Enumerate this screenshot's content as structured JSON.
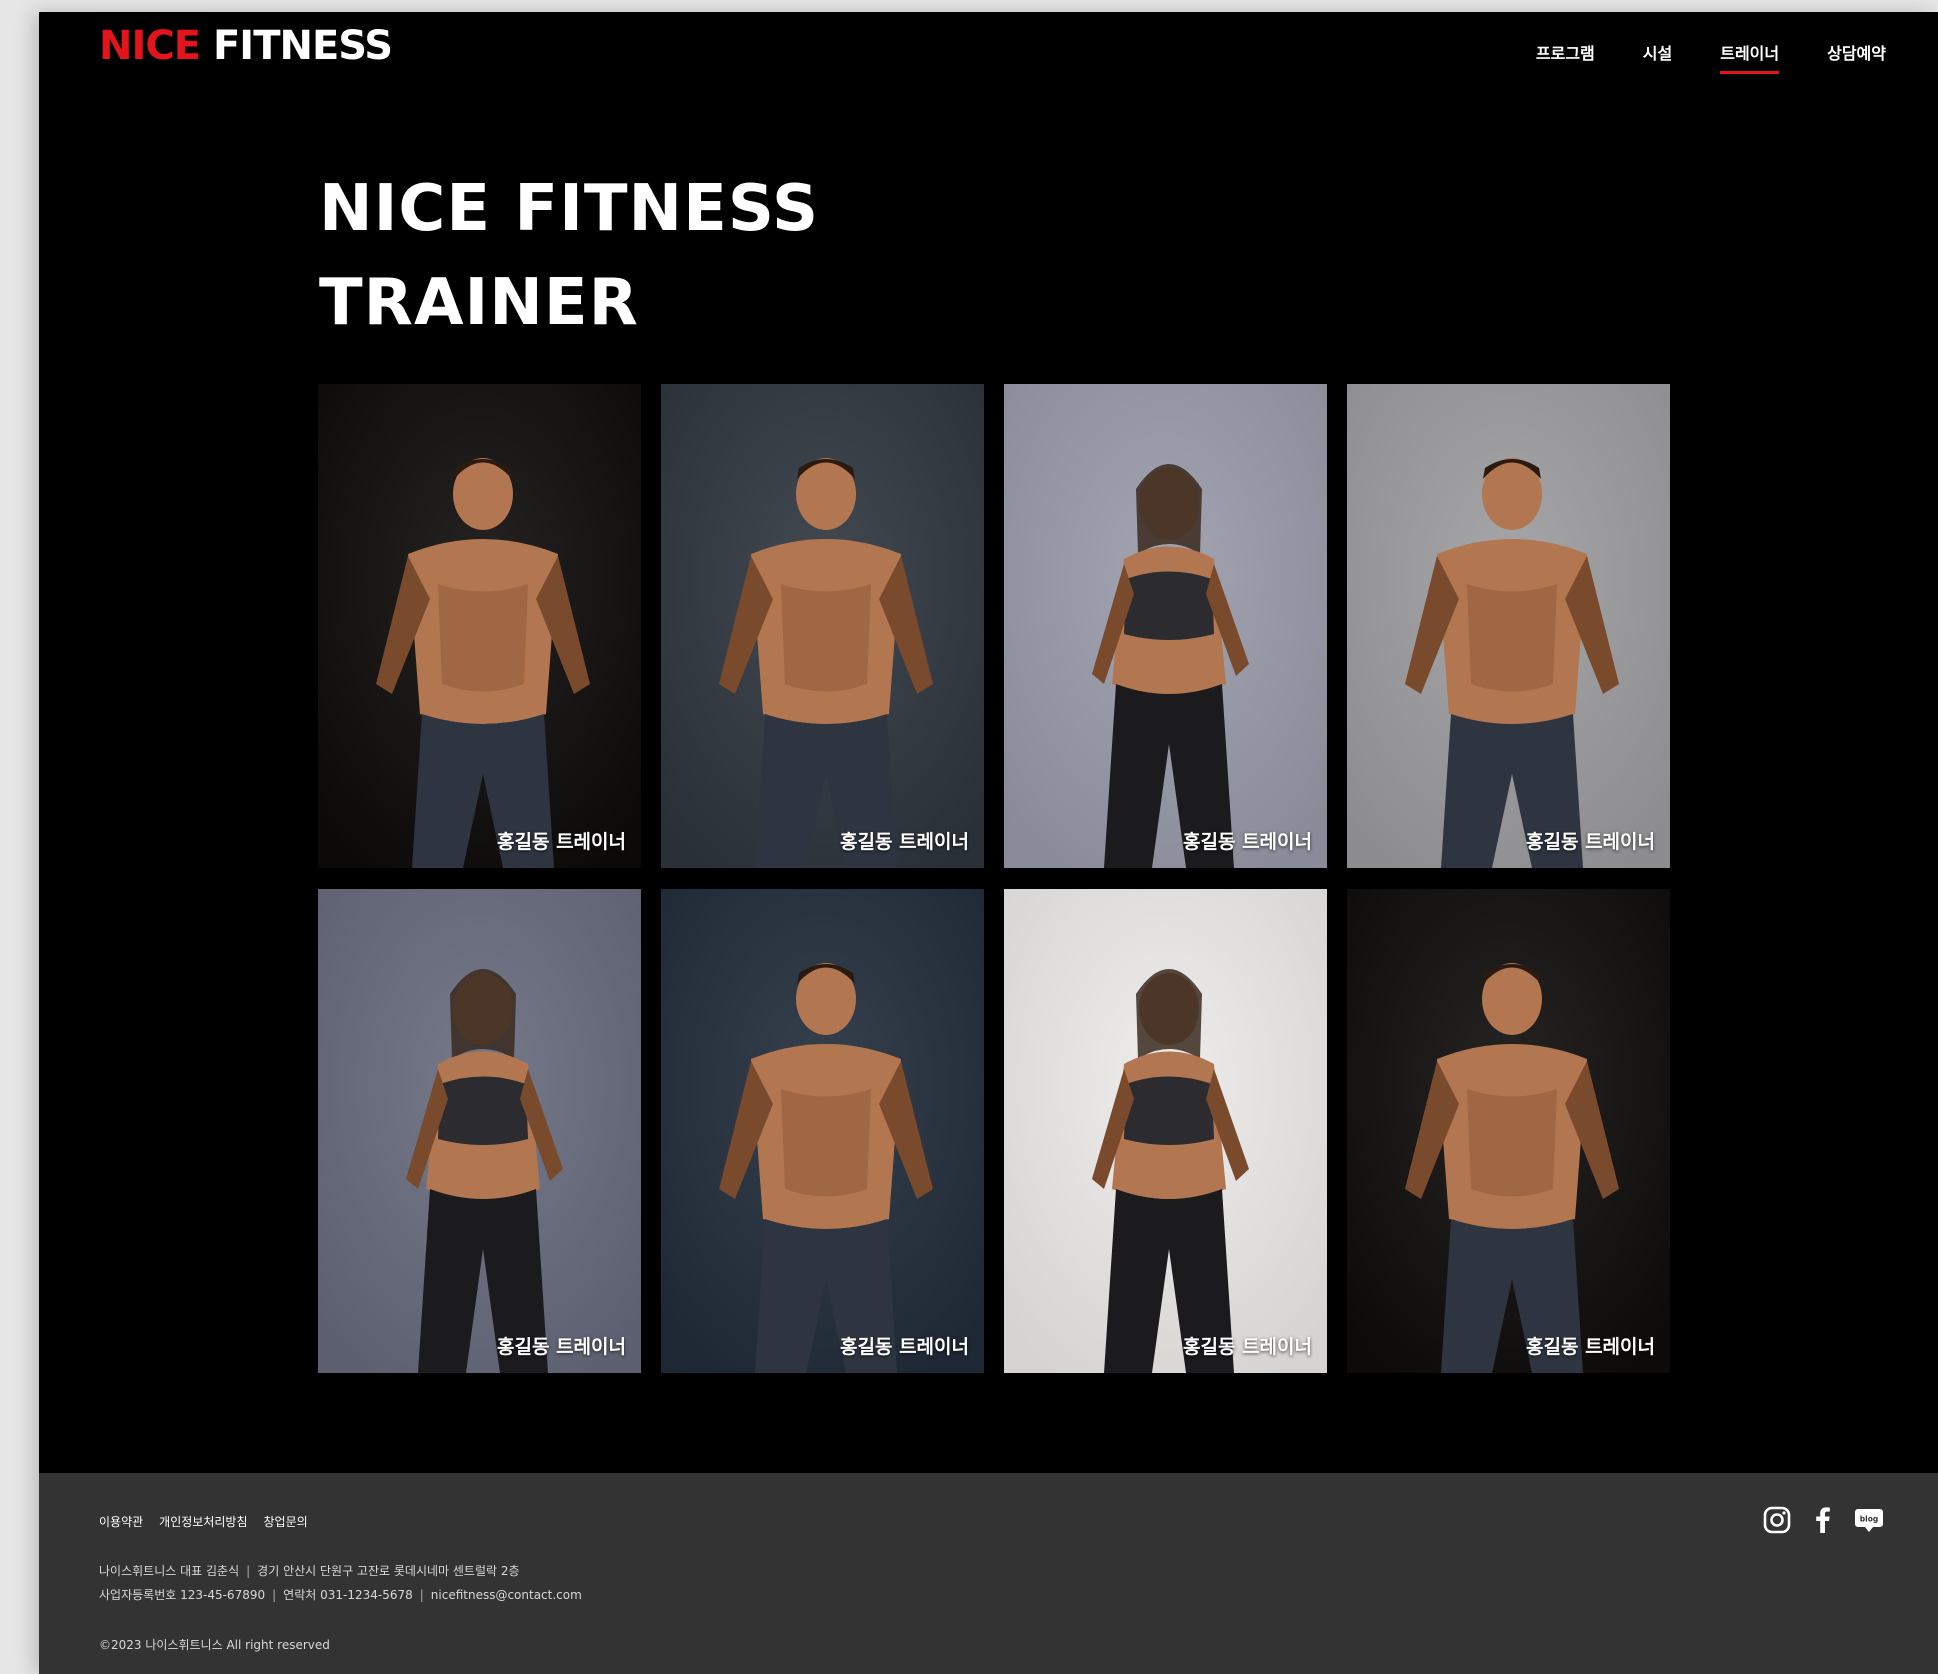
{
  "brand": {
    "logo_part1": "NICE",
    "logo_part2": "FITNESS",
    "accent": "#e4141c"
  },
  "nav": {
    "items": [
      {
        "label": "프로그램",
        "active": false
      },
      {
        "label": "시설",
        "active": false
      },
      {
        "label": "트레이너",
        "active": true
      },
      {
        "label": "상담예약",
        "active": false
      }
    ]
  },
  "hero": {
    "line1": "NICE FITNESS",
    "line2": "TRAINER"
  },
  "trainers": [
    {
      "label": "홍길동 트레이너",
      "bg": "#0c0a09",
      "figure": "male"
    },
    {
      "label": "홍길동 트레이너",
      "bg": "#2a3038",
      "figure": "male"
    },
    {
      "label": "홍길동 트레이너",
      "bg": "#8a8b98",
      "figure": "female"
    },
    {
      "label": "홍길동 트레이너",
      "bg": "#8d8d8f",
      "figure": "male"
    },
    {
      "label": "홍길동 트레이너",
      "bg": "#5c6070",
      "figure": "female"
    },
    {
      "label": "홍길동 트레이너",
      "bg": "#1e2834",
      "figure": "male"
    },
    {
      "label": "홍길동 트레이너",
      "bg": "#d6d4d2",
      "figure": "female"
    },
    {
      "label": "홍길동 트레이너",
      "bg": "#0d0b0a",
      "figure": "male"
    }
  ],
  "footer": {
    "links": [
      "이용약관",
      "개인정보처리방침",
      "창업문의"
    ],
    "info_line1": [
      "나이스휘트니스 대표 김춘식",
      "경기 안산시 단원구 고잔로 롯데시네마 센트럴락 2층"
    ],
    "info_line2": [
      "사업자등록번호 123-45-67890",
      "연락처 031-1234-5678",
      "nicefitness@contact.com"
    ],
    "copyright": "©2023 나이스휘트니스 All right reserved",
    "socials": [
      {
        "name": "instagram-icon"
      },
      {
        "name": "facebook-icon"
      },
      {
        "name": "blog-icon",
        "text": "blog"
      }
    ]
  }
}
